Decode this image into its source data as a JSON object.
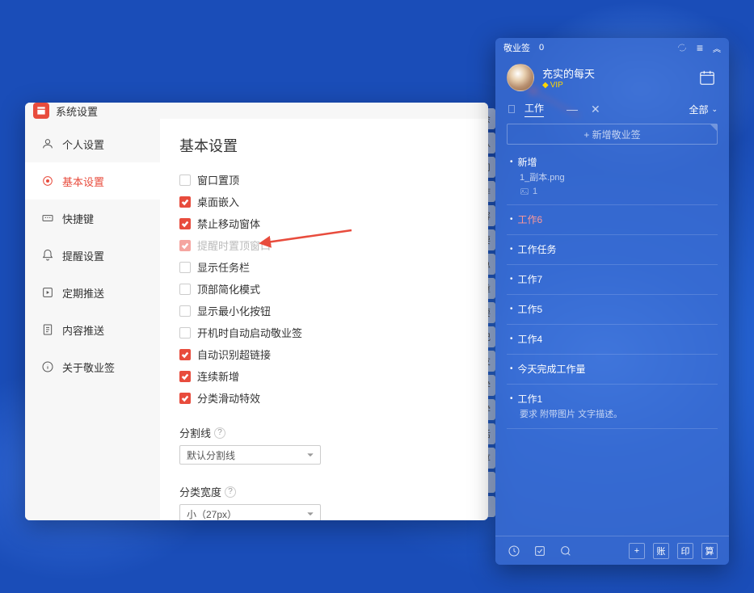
{
  "settings": {
    "window_title": "系统设置",
    "sidebar": [
      {
        "id": "personal",
        "label": "个人设置"
      },
      {
        "id": "basic",
        "label": "基本设置"
      },
      {
        "id": "shortcut",
        "label": "快捷键"
      },
      {
        "id": "reminder",
        "label": "提醒设置"
      },
      {
        "id": "schedule",
        "label": "定期推送"
      },
      {
        "id": "content",
        "label": "内容推送"
      },
      {
        "id": "about",
        "label": "关于敬业签"
      }
    ],
    "content_title": "基本设置",
    "checkboxes": [
      {
        "label": "窗口置顶",
        "checked": false
      },
      {
        "label": "桌面嵌入",
        "checked": true
      },
      {
        "label": "禁止移动窗体",
        "checked": true
      },
      {
        "label": "提醒时置顶窗口",
        "checked": true,
        "disabled": true
      },
      {
        "label": "显示任务栏",
        "checked": false
      },
      {
        "label": "顶部简化模式",
        "checked": false
      },
      {
        "label": "显示最小化按钮",
        "checked": false
      },
      {
        "label": "开机时自动启动敬业签",
        "checked": false
      },
      {
        "label": "自动识别超链接",
        "checked": true
      },
      {
        "label": "连续新增",
        "checked": true
      },
      {
        "label": "分类滑动特效",
        "checked": true
      }
    ],
    "divider_label": "分割线",
    "divider_value": "默认分割线",
    "width_label": "分类宽度",
    "width_value": "小（27px）"
  },
  "notes": {
    "app_name": "敬业签",
    "bell_count": "0",
    "user_name": "充实的每天",
    "vip_text": "VIP",
    "current_tab": "工作",
    "filter_label": "全部",
    "add_placeholder": "+ 新增敬业签",
    "items": [
      {
        "title": "新增",
        "sub": "1_副本.png",
        "attach_count": "1"
      },
      {
        "title": "工作6",
        "red": true
      },
      {
        "title": "工作任务"
      },
      {
        "title": "工作7"
      },
      {
        "title": "工作5"
      },
      {
        "title": "工作4"
      },
      {
        "title": "今天完成工作量"
      },
      {
        "title": "工作1",
        "sub": "要求  附带图片 文字描述。"
      }
    ],
    "footer_buttons": [
      "+",
      "账",
      "印",
      "算"
    ]
  },
  "bg_tabs": [
    "班会",
    "默认",
    "公司",
    "工作",
    "内容",
    "重要",
    "紧急",
    "不重",
    "重要",
    "笔记",
    "朋友",
    "开学",
    "新学",
    "生活",
    "分享"
  ]
}
